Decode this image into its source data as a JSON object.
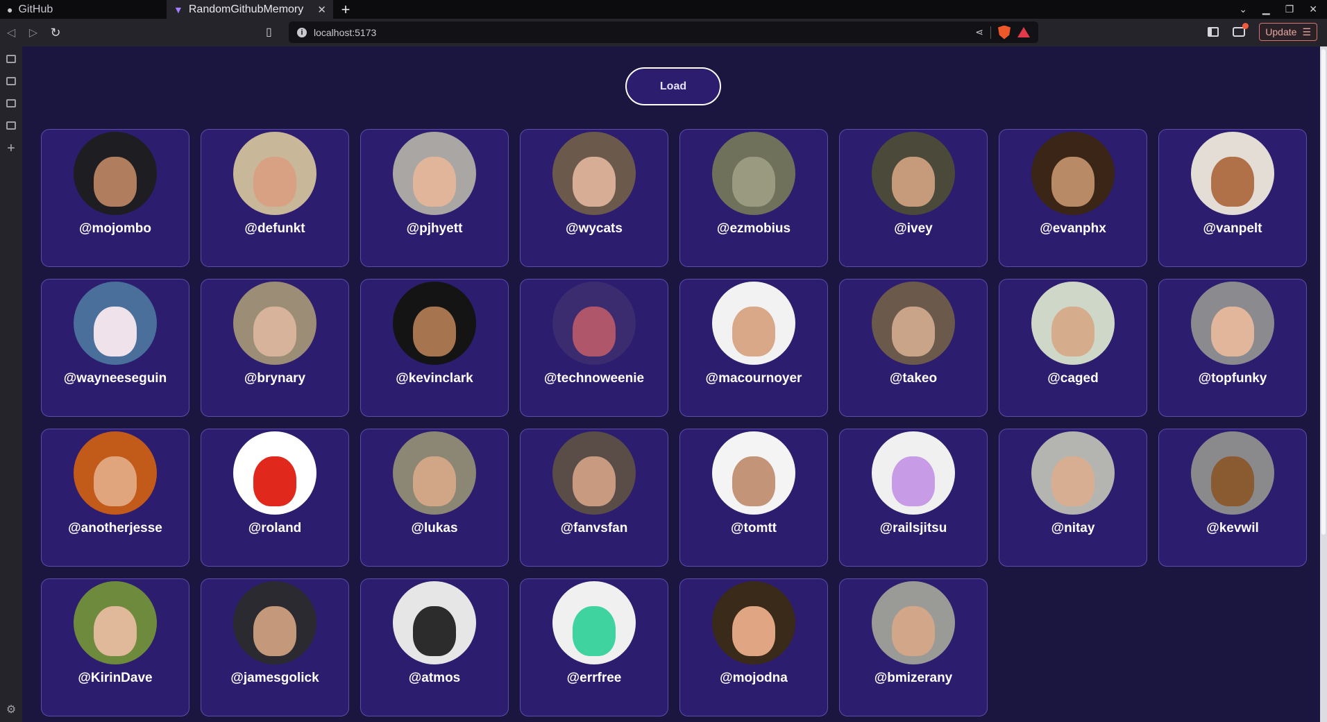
{
  "browser": {
    "tabs": [
      {
        "title": "GitHub",
        "active": false
      },
      {
        "title": "RandomGithubMemory",
        "active": true
      }
    ],
    "url": "localhost:5173",
    "update_label": "Update"
  },
  "app": {
    "load_label": "Load",
    "users": [
      {
        "username": "@mojombo",
        "bg": "#1e1e22",
        "face": "#b07d5e"
      },
      {
        "username": "@defunkt",
        "bg": "#c9b79a",
        "face": "#d9a184"
      },
      {
        "username": "@pjhyett",
        "bg": "#a9a6a4",
        "face": "#e1b59a"
      },
      {
        "username": "@wycats",
        "bg": "#6b5a4c",
        "face": "#d7ae95"
      },
      {
        "username": "@ezmobius",
        "bg": "#6f715b",
        "face": "#9a9a80"
      },
      {
        "username": "@ivey",
        "bg": "#4b4a3a",
        "face": "#c59b7c"
      },
      {
        "username": "@evanphx",
        "bg": "#3a2516",
        "face": "#b88a66"
      },
      {
        "username": "@vanpelt",
        "bg": "#e3ddd6",
        "face": "#b07048"
      },
      {
        "username": "@wayneeseguin",
        "bg": "#4a6f9a",
        "face": "#f0e2ea"
      },
      {
        "username": "@brynary",
        "bg": "#9b8d76",
        "face": "#d6b39a"
      },
      {
        "username": "@kevinclark",
        "bg": "#141414",
        "face": "#a6754f"
      },
      {
        "username": "@technoweenie",
        "bg": "#3a2c6e",
        "face": "#b0566a"
      },
      {
        "username": "@macournoyer",
        "bg": "#f2f2f2",
        "face": "#d8a888"
      },
      {
        "username": "@takeo",
        "bg": "#6b5a4c",
        "face": "#caa488"
      },
      {
        "username": "@caged",
        "bg": "#cfd7c8",
        "face": "#d6ad8c"
      },
      {
        "username": "@topfunky",
        "bg": "#8b8b8f",
        "face": "#e2b69b"
      },
      {
        "username": "@anotherjesse",
        "bg": "#c25a1a",
        "face": "#e0a57c"
      },
      {
        "username": "@roland",
        "bg": "#ffffff",
        "face": "#e0281c"
      },
      {
        "username": "@lukas",
        "bg": "#8c8674",
        "face": "#d0a687"
      },
      {
        "username": "@fanvsfan",
        "bg": "#5a4c47",
        "face": "#c89a80"
      },
      {
        "username": "@tomtt",
        "bg": "#f4f4f4",
        "face": "#c49478"
      },
      {
        "username": "@railsjitsu",
        "bg": "#f0f0f0",
        "face": "#c79be5"
      },
      {
        "username": "@nitay",
        "bg": "#b4b4b0",
        "face": "#d8ae92"
      },
      {
        "username": "@kevwil",
        "bg": "#8a8a8c",
        "face": "#8a5a30"
      },
      {
        "username": "@KirinDave",
        "bg": "#6e8a3c",
        "face": "#e0b89a"
      },
      {
        "username": "@jamesgolick",
        "bg": "#2a2a30",
        "face": "#c4987a"
      },
      {
        "username": "@atmos",
        "bg": "#e6e6e6",
        "face": "#2c2c2c"
      },
      {
        "username": "@errfree",
        "bg": "#f0f0f0",
        "face": "#3fd3a0"
      },
      {
        "username": "@mojodna",
        "bg": "#3a2a1a",
        "face": "#e0a583"
      },
      {
        "username": "@bmizerany",
        "bg": "#9a9a96",
        "face": "#d2a688"
      }
    ]
  }
}
